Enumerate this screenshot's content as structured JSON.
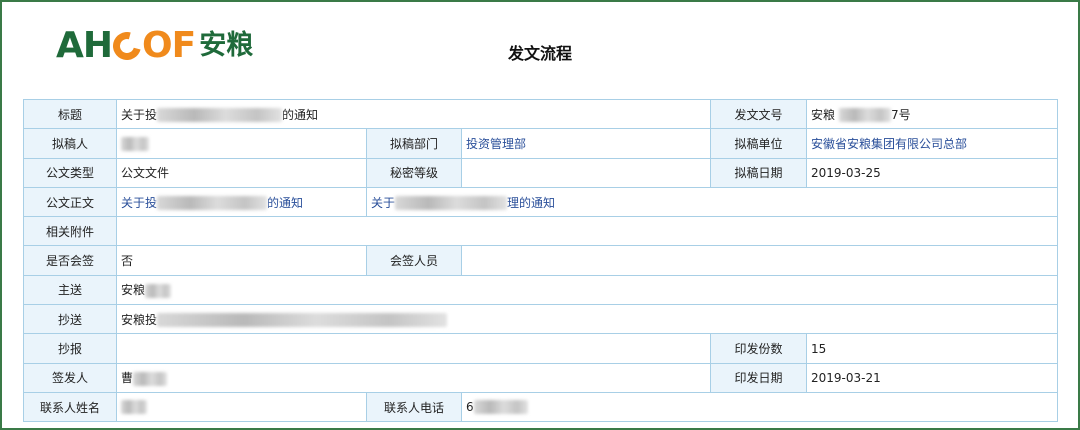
{
  "header": {
    "logo_latin_1": "AH",
    "logo_latin_2": "C",
    "logo_latin_3": "OF",
    "logo_cn": "安粮",
    "page_title": "发文流程"
  },
  "labels": {
    "title": "标题",
    "doc_no": "发文文号",
    "drafter": "拟稿人",
    "draft_dept": "拟稿部门",
    "draft_unit": "拟稿单位",
    "doc_type": "公文类型",
    "secret_level": "秘密等级",
    "draft_date": "拟稿日期",
    "doc_body": "公文正文",
    "attachments": "相关附件",
    "countersign": "是否会签",
    "countersign_people": "会签人员",
    "main_recipient": "主送",
    "cc": "抄送",
    "report": "抄报",
    "print_copies": "印发份数",
    "issuer": "签发人",
    "print_date": "印发日期",
    "contact_name": "联系人姓名",
    "contact_phone": "联系人电话"
  },
  "values": {
    "title_prefix": "关于投",
    "title_suffix": "的通知",
    "doc_no_prefix": "安粮",
    "doc_no_suffix": "7号",
    "draft_dept": "投资管理部",
    "draft_unit": "安徽省安粮集团有限公司总部",
    "doc_type": "公文文件",
    "secret_level": "",
    "draft_date": "2019-03-25",
    "doc_body_link1_prefix": "关于投",
    "doc_body_link1_suffix": "的通知",
    "doc_body_link2_prefix": "关于",
    "doc_body_link2_suffix": "理的通知",
    "attachments": "",
    "countersign": "否",
    "countersign_people": "",
    "main_recipient_prefix": "安粮",
    "cc_prefix": "安粮投",
    "report": "",
    "print_copies": "15",
    "issuer_prefix": "曹",
    "print_date": "2019-03-21",
    "contact_phone_prefix": "6"
  }
}
